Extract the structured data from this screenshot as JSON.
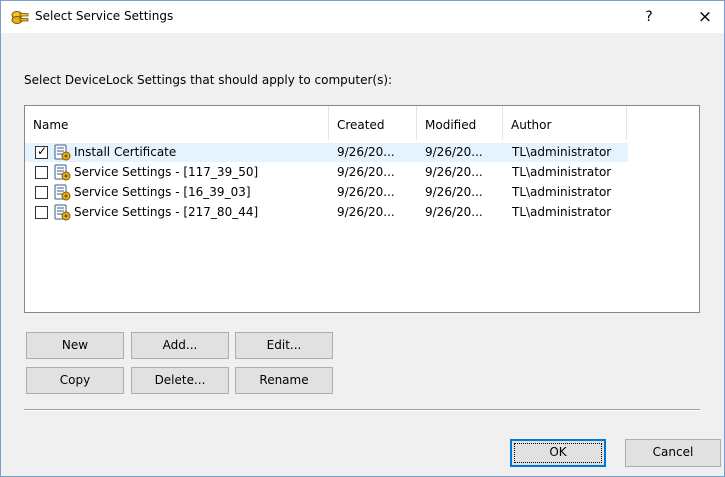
{
  "window": {
    "title": "Select Service Settings",
    "help_label": "?",
    "close_label": "×"
  },
  "instruction": "Select DeviceLock Settings that should apply to computer(s):",
  "table": {
    "columns": [
      "Name",
      "Created",
      "Modified",
      "Author"
    ],
    "rows": [
      {
        "checked": true,
        "name": "Install Certificate",
        "created": "9/26/20...",
        "modified": "9/26/20...",
        "author": "TL\\administrator"
      },
      {
        "checked": false,
        "name": "Service Settings - [117_39_50]",
        "created": "9/26/20...",
        "modified": "9/26/20...",
        "author": "TL\\administrator"
      },
      {
        "checked": false,
        "name": "Service Settings - [16_39_03]",
        "created": "9/26/20...",
        "modified": "9/26/20...",
        "author": "TL\\administrator"
      },
      {
        "checked": false,
        "name": "Service Settings - [217_80_44]",
        "created": "9/26/20...",
        "modified": "9/26/20...",
        "author": "TL\\administrator"
      }
    ]
  },
  "buttons": {
    "new": "New",
    "add": "Add...",
    "edit": "Edit...",
    "copy": "Copy",
    "delete": "Delete...",
    "rename": "Rename",
    "ok": "OK",
    "cancel": "Cancel"
  },
  "icons": {
    "app": "keys-icon",
    "row": "settings-scroll-icon",
    "check": "✓"
  },
  "colors": {
    "selected_row": "#e5f3ff",
    "default_button_border": "#0078d7"
  }
}
